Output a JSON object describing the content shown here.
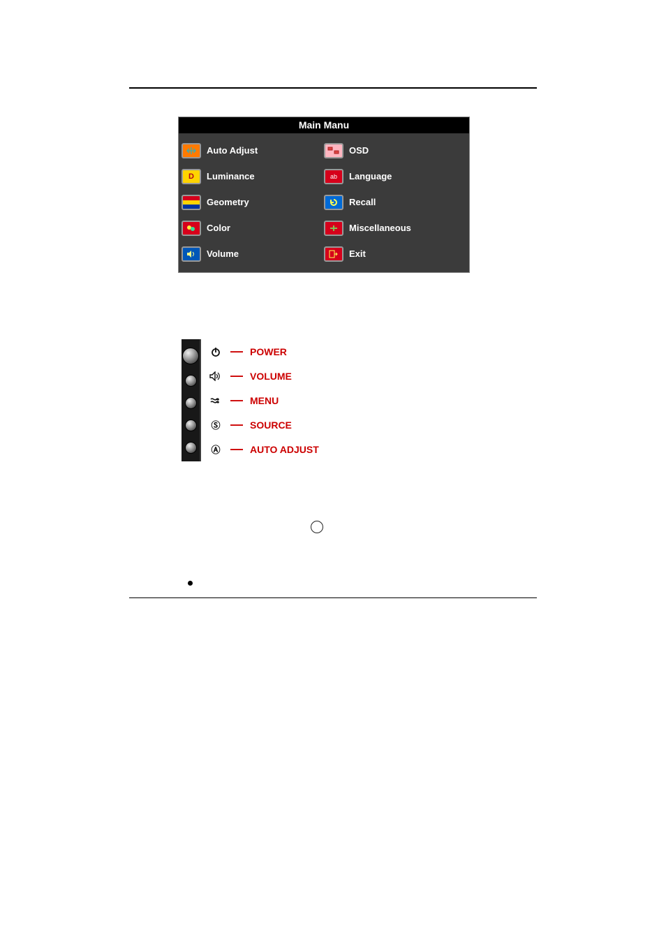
{
  "osd": {
    "title": "Main Manu",
    "left_items": [
      {
        "label": "Auto Adjust",
        "name": "autoadjust"
      },
      {
        "label": "Luminance",
        "name": "luminance"
      },
      {
        "label": "Geometry",
        "name": "geometry"
      },
      {
        "label": "Color",
        "name": "color"
      },
      {
        "label": "Volume",
        "name": "volume"
      }
    ],
    "right_items": [
      {
        "label": "OSD",
        "name": "osd"
      },
      {
        "label": "Language",
        "name": "language"
      },
      {
        "label": "Recall",
        "name": "recall"
      },
      {
        "label": "Miscellaneous",
        "name": "misc"
      },
      {
        "label": "Exit",
        "name": "exit"
      }
    ]
  },
  "buttons": [
    {
      "label": "POWER",
      "symbol": "⏻",
      "size": 24
    },
    {
      "label": "VOLUME",
      "symbol": "🕩",
      "size": 17
    },
    {
      "label": "MENU",
      "symbol": "✦",
      "size": 17
    },
    {
      "label": "SOURCE",
      "symbol": "Ⓢ",
      "size": 17
    },
    {
      "label": "AUTO ADJUST",
      "symbol": "Ⓐ",
      "size": 17
    }
  ]
}
